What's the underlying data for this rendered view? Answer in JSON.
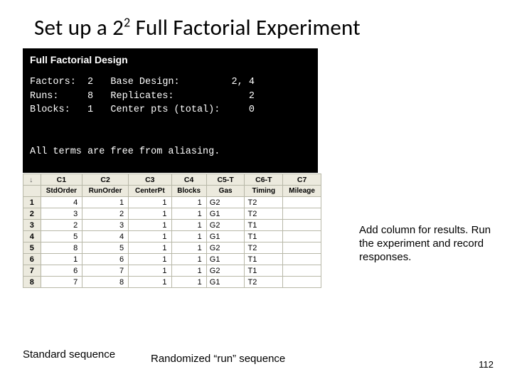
{
  "title_pre": "Set up a 2",
  "title_sup": "2",
  "title_post": " Full Factorial Experiment",
  "terminal": {
    "header": "Full Factorial Design",
    "body": "Factors:  2   Base Design:         2, 4\nRuns:     8   Replicates:             2\nBlocks:   1   Center pts (total):     0\n\n\nAll terms are free from aliasing."
  },
  "table": {
    "col_headers_r1": [
      "C1",
      "C2",
      "C3",
      "C4",
      "C5-T",
      "C6-T",
      "C7"
    ],
    "col_headers_r2": [
      "StdOrder",
      "RunOrder",
      "CenterPt",
      "Blocks",
      "Gas",
      "Timing",
      "Mileage"
    ],
    "rows": [
      {
        "n": "1",
        "std": "4",
        "run": "1",
        "cp": "1",
        "blk": "1",
        "gas": "G2",
        "tim": "T2",
        "mil": ""
      },
      {
        "n": "2",
        "std": "3",
        "run": "2",
        "cp": "1",
        "blk": "1",
        "gas": "G1",
        "tim": "T2",
        "mil": ""
      },
      {
        "n": "3",
        "std": "2",
        "run": "3",
        "cp": "1",
        "blk": "1",
        "gas": "G2",
        "tim": "T1",
        "mil": ""
      },
      {
        "n": "4",
        "std": "5",
        "run": "4",
        "cp": "1",
        "blk": "1",
        "gas": "G1",
        "tim": "T1",
        "mil": ""
      },
      {
        "n": "5",
        "std": "8",
        "run": "5",
        "cp": "1",
        "blk": "1",
        "gas": "G2",
        "tim": "T2",
        "mil": ""
      },
      {
        "n": "6",
        "std": "1",
        "run": "6",
        "cp": "1",
        "blk": "1",
        "gas": "G1",
        "tim": "T1",
        "mil": ""
      },
      {
        "n": "7",
        "std": "6",
        "run": "7",
        "cp": "1",
        "blk": "1",
        "gas": "G2",
        "tim": "T1",
        "mil": ""
      },
      {
        "n": "8",
        "std": "7",
        "run": "8",
        "cp": "1",
        "blk": "1",
        "gas": "G1",
        "tim": "T2",
        "mil": ""
      }
    ]
  },
  "side_note": "Add column for results. Run the experiment and record responses.",
  "caption_left": "Standard sequence",
  "caption_mid": "Randomized “run” sequence",
  "page_num": "112"
}
